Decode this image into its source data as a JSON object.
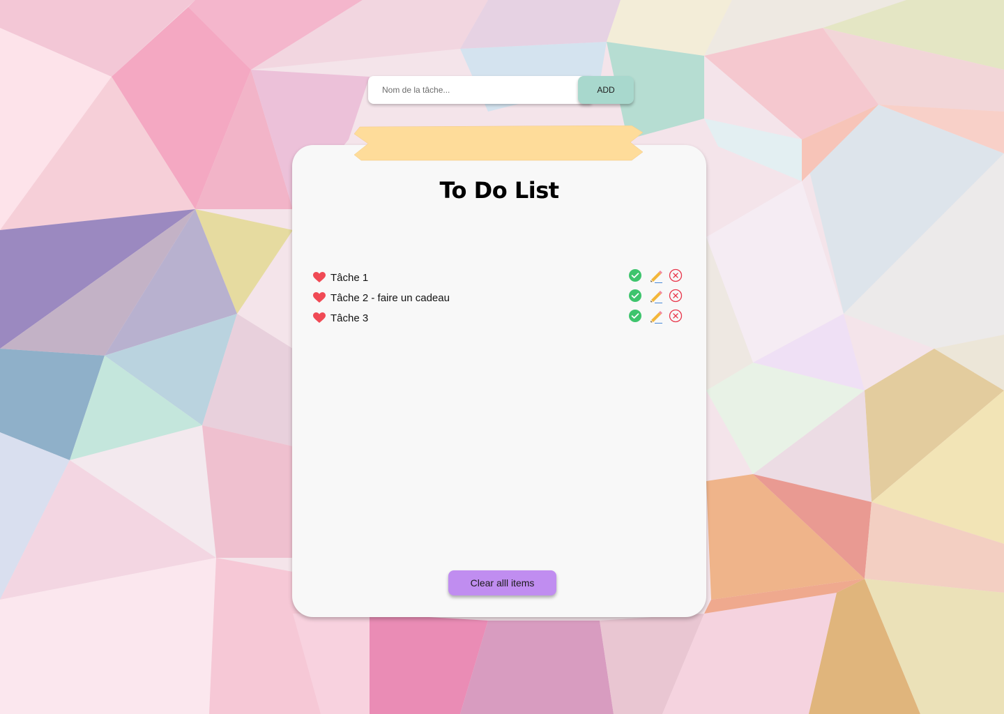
{
  "add_form": {
    "placeholder": "Nom de la tâche...",
    "value": "",
    "add_label": "ADD"
  },
  "card": {
    "title": "To Do List",
    "tasks": [
      {
        "label": "Tâche 1"
      },
      {
        "label": "Tâche 2 - faire un cadeau"
      },
      {
        "label": "Tâche 3"
      }
    ],
    "clear_label": "Clear alll items"
  },
  "icons": {
    "task_bullet": "heart-icon",
    "complete": "check-circle-icon",
    "edit": "pencil-icon",
    "delete": "close-circle-icon"
  },
  "colors": {
    "add_button": "#a8d8cd",
    "clear_button": "#c08df0",
    "tape": "#fedc9a",
    "heart": "#f04a55",
    "check": "#3ec46d",
    "delete": "#e8364b",
    "card": "#f8f8f8"
  }
}
